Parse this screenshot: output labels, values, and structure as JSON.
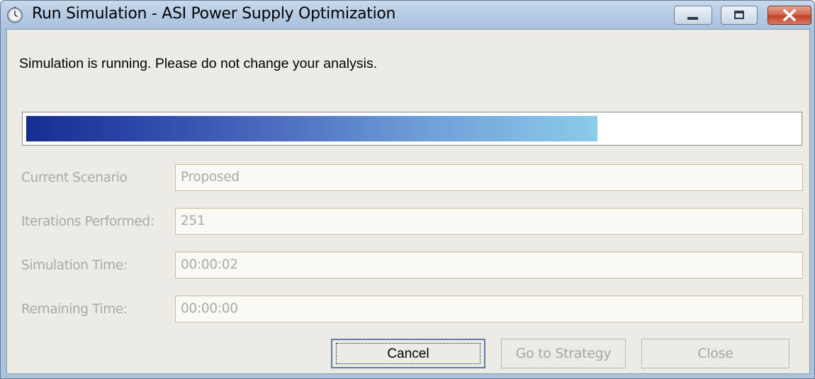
{
  "window": {
    "title": "Run Simulation - ASI Power Supply Optimization",
    "accent_color": "#a9c2dd",
    "close_button_color": "#c3402a"
  },
  "status_message": "Simulation is running. Please do not change your analysis.",
  "progress": {
    "fraction": 0.74,
    "colors": [
      "#162d92",
      "#8ccbe9"
    ]
  },
  "fields": [
    {
      "label": "Current Scenario",
      "value": "Proposed"
    },
    {
      "label": "Iterations Performed:",
      "value": "251"
    },
    {
      "label": "Simulation Time:",
      "value": "00:00:02"
    },
    {
      "label": "Remaining Time:",
      "value": "00:00:00"
    }
  ],
  "buttons": {
    "cancel": "Cancel",
    "go_to_strategy": "Go to Strategy",
    "close": "Close"
  },
  "icons": {
    "app": "stopwatch-icon",
    "minimize": "minimize-icon",
    "maximize": "maximize-icon",
    "close": "close-icon"
  }
}
